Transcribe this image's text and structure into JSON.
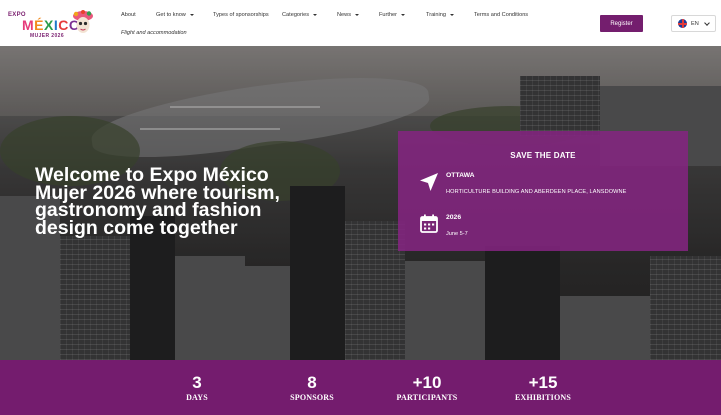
{
  "header": {
    "logo": {
      "expo": "EXPO",
      "mexico": "MÉXICO",
      "mujer": "MUJER 2026"
    },
    "nav": [
      {
        "label": "About",
        "dropdown": false
      },
      {
        "label": "Get to know",
        "dropdown": true
      },
      {
        "label": "Types of sponsorships",
        "dropdown": false
      },
      {
        "label": "Categories",
        "dropdown": true
      },
      {
        "label": "News",
        "dropdown": true
      },
      {
        "label": "Further",
        "dropdown": true
      },
      {
        "label": "Training",
        "dropdown": true
      },
      {
        "label": "Terms and Conditions",
        "dropdown": false
      },
      {
        "label": "Flight and accommodation",
        "dropdown": false
      }
    ],
    "register_label": "Register",
    "language": "EN"
  },
  "hero": {
    "title": "Welcome to Expo México Mujer 2026 where tourism, gastronomy and fashion design come together"
  },
  "save_the_date": {
    "title": "SAVE THE DATE",
    "city": "OTTAWA",
    "venue": "HORTICULTURE BUILDING AND ABERDEEN PLACE, LANSDOWNE",
    "year": "2026",
    "dates": "June 5-7"
  },
  "stats": [
    {
      "number": "3",
      "label": "DAYS"
    },
    {
      "number": "8",
      "label": "SPONSORS"
    },
    {
      "number": "+10",
      "label": "PARTICIPANTS"
    },
    {
      "number": "+15",
      "label": "EXHIBITIONS"
    }
  ],
  "colors": {
    "brand_purple": "#741e6e",
    "card_purple": "#832480"
  }
}
